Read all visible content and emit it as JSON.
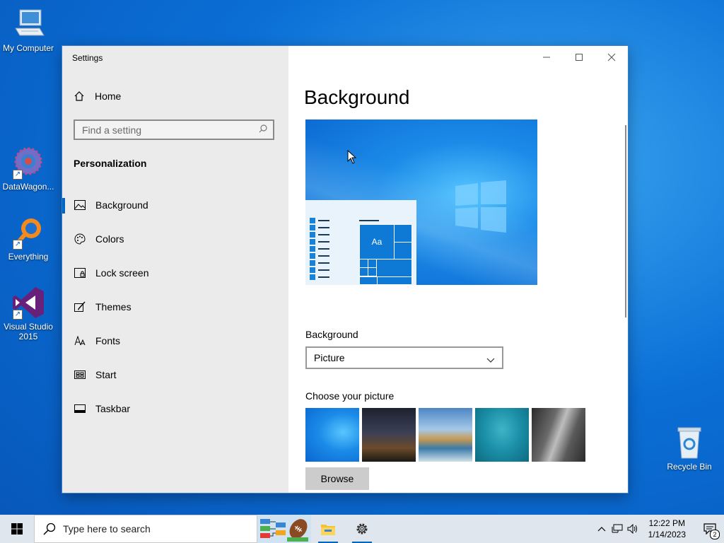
{
  "desktop": {
    "icons": [
      {
        "label": "My Computer"
      },
      {
        "label": "DataWagon..."
      },
      {
        "label": "Everything"
      },
      {
        "label": "Visual Studio 2015"
      },
      {
        "label": "Recycle Bin"
      }
    ]
  },
  "window": {
    "title": "Settings",
    "controls": {
      "minimize": "—",
      "maximize": "☐",
      "close": "✕"
    }
  },
  "sidebar": {
    "home_label": "Home",
    "search_placeholder": "Find a setting",
    "section_title": "Personalization",
    "items": [
      {
        "label": "Background",
        "icon": "picture-icon",
        "active": true
      },
      {
        "label": "Colors",
        "icon": "palette-icon"
      },
      {
        "label": "Lock screen",
        "icon": "lock-screen-icon"
      },
      {
        "label": "Themes",
        "icon": "themes-icon"
      },
      {
        "label": "Fonts",
        "icon": "fonts-icon"
      },
      {
        "label": "Start",
        "icon": "start-icon"
      },
      {
        "label": "Taskbar",
        "icon": "taskbar-icon"
      }
    ]
  },
  "main": {
    "page_title": "Background",
    "preview": {
      "tile_label": "Aa"
    },
    "background_label": "Background",
    "background_value": "Picture",
    "choose_label": "Choose your picture",
    "browse_label": "Browse"
  },
  "taskbar": {
    "search_placeholder": "Type here to search",
    "time": "12:22 PM",
    "date": "1/14/2023",
    "notification_count": "2"
  },
  "colors": {
    "accent": "#0067c0",
    "sidebar_bg": "#ebebeb",
    "taskbar_bg": "#dfe6ee"
  }
}
